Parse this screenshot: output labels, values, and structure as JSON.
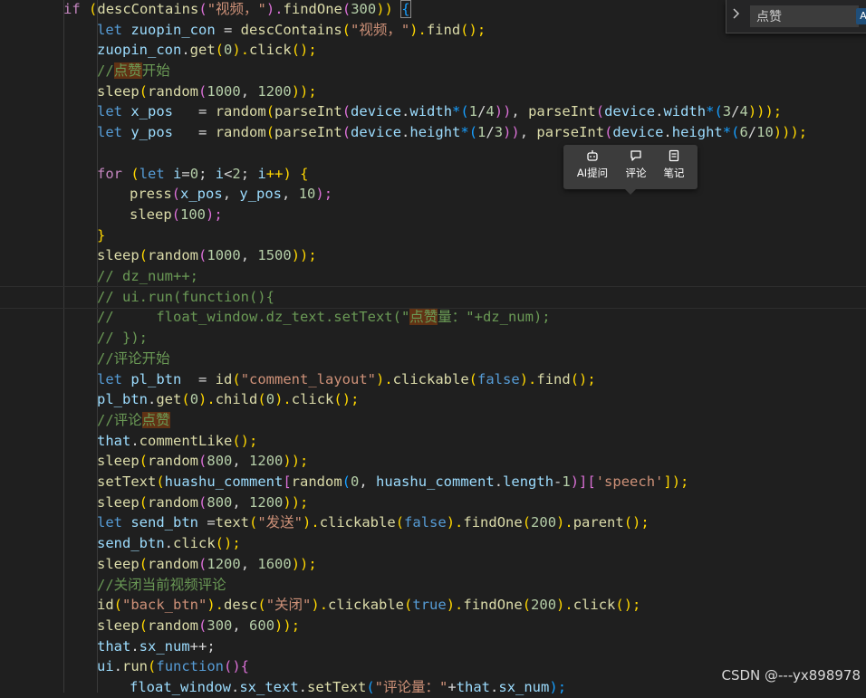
{
  "find_widget": {
    "query": "点赞",
    "toggle_icon": "chevron-right-icon",
    "case_label": "A"
  },
  "selection_toolbar": {
    "ai": "AI提问",
    "comment": "评论",
    "notes": "笔记"
  },
  "watermark": "CSDN @---yx898978",
  "code": {
    "l1": {
      "t1": "if",
      "t2": "(",
      "t3": "descContains",
      "t4": "(",
      "t5": "\"视频，\"",
      "t6": ").",
      "t7": "findOne",
      "t8": "(",
      "t9": "300",
      "t10": "))",
      "t11": "{"
    },
    "l2": {
      "t1": "let",
      "t2": "zuopin_con",
      "t3": " = ",
      "t4": "descContains",
      "t5": "(",
      "t6": "\"视频，\"",
      "t7": ").",
      "t8": "find",
      "t9": "();"
    },
    "l3": {
      "t1": "zuopin_con",
      "t2": ".",
      "t3": "get",
      "t4": "(",
      "t5": "0",
      "t6": ").",
      "t7": "click",
      "t8": "();"
    },
    "l4": {
      "t1": "//",
      "t2": "点赞",
      "t3": "开始"
    },
    "l5": {
      "t1": "sleep",
      "t2": "(",
      "t3": "random",
      "t4": "(",
      "t5": "1000",
      "t6": ", ",
      "t7": "1200",
      "t8": "));"
    },
    "l6": {
      "t1": "let",
      "t2": "x_pos",
      "t3": "   = ",
      "t4": "random",
      "t5": "(",
      "t6": "parseInt",
      "t7": "(",
      "t8": "device",
      "t9": ".",
      "t10": "width",
      "t11": "*(",
      "t12": "1",
      "t13": "/",
      "t14": "4",
      "t15": "))",
      "t16": ", ",
      "t17": "parseInt",
      "t18": "(",
      "t19": "device",
      "t20": ".",
      "t21": "width",
      "t22": "*(",
      "t23": "3",
      "t24": "/",
      "t25": "4",
      "t26": ")));"
    },
    "l7": {
      "t1": "let",
      "t2": "y_pos",
      "t3": "   = ",
      "t4": "random",
      "t5": "(",
      "t6": "parseInt",
      "t7": "(",
      "t8": "device",
      "t9": ".",
      "t10": "height",
      "t11": "*(",
      "t12": "1",
      "t13": "/",
      "t14": "3",
      "t15": "))",
      "t16": ", ",
      "t17": "parseInt",
      "t18": "(",
      "t19": "device",
      "t20": ".",
      "t21": "height",
      "t22": "*(",
      "t23": "6",
      "t24": "/",
      "t25": "10",
      "t26": ")));"
    },
    "l8": {
      "t1": "for",
      "t2": "(",
      "t3": "let",
      "t4": "i",
      "t5": "=",
      "t6": "0",
      "t7": "; ",
      "t8": "i",
      "t9": "<",
      "t10": "2",
      "t11": "; ",
      "t12": "i",
      "t13": "++) ",
      "t14": "{"
    },
    "l9": {
      "t1": "press",
      "t2": "(",
      "t3": "x_pos",
      "t4": ", ",
      "t5": "y_pos",
      "t6": ", ",
      "t7": "10",
      "t8": ");"
    },
    "l10": {
      "t1": "sleep",
      "t2": "(",
      "t3": "100",
      "t4": ");"
    },
    "l11": {
      "t1": "}"
    },
    "l12": {
      "t1": "sleep",
      "t2": "(",
      "t3": "random",
      "t4": "(",
      "t5": "1000",
      "t6": ", ",
      "t7": "1500",
      "t8": "));"
    },
    "l13": {
      "t1": "// dz_num++;"
    },
    "l14": {
      "t1": "// ui.run(function(){"
    },
    "l15": {
      "t1": "//     float_window.dz_text.setText(\"",
      "t2": "点赞",
      "t3": "量：\"+dz_num);"
    },
    "l16": {
      "t1": "// });"
    },
    "l17": {
      "t1": "//评论开始"
    },
    "l18": {
      "t1": "let",
      "t2": "pl_btn",
      "t3": "  = ",
      "t4": "id",
      "t5": "(",
      "t6": "\"comment_layout\"",
      "t7": ").",
      "t8": "clickable",
      "t9": "(",
      "t10": "false",
      "t11": ").",
      "t12": "find",
      "t13": "();"
    },
    "l19": {
      "t1": "pl_btn",
      "t2": ".",
      "t3": "get",
      "t4": "(",
      "t5": "0",
      "t6": ").",
      "t7": "child",
      "t8": "(",
      "t9": "0",
      "t10": ").",
      "t11": "click",
      "t12": "();"
    },
    "l20": {
      "t1": "//评论",
      "t2": "点赞"
    },
    "l21": {
      "t1": "that",
      "t2": ".",
      "t3": "commentLike",
      "t4": "();"
    },
    "l22": {
      "t1": "sleep",
      "t2": "(",
      "t3": "random",
      "t4": "(",
      "t5": "800",
      "t6": ", ",
      "t7": "1200",
      "t8": "));"
    },
    "l23": {
      "t1": "setText",
      "t2": "(",
      "t3": "huashu_comment",
      "t4": "[",
      "t5": "random",
      "t6": "(",
      "t7": "0",
      "t8": ", ",
      "t9": "huashu_comment",
      "t10": ".",
      "t11": "length",
      "t12": "-",
      "t13": "1",
      "t14": ")][",
      "t15": "'speech'",
      "t16": "]);"
    },
    "l24": {
      "t1": "sleep",
      "t2": "(",
      "t3": "random",
      "t4": "(",
      "t5": "800",
      "t6": ", ",
      "t7": "1200",
      "t8": "));"
    },
    "l25": {
      "t1": "let",
      "t2": "send_btn",
      "t3": " =",
      "t4": "text",
      "t5": "(",
      "t6": "\"发送\"",
      "t7": ").",
      "t8": "clickable",
      "t9": "(",
      "t10": "false",
      "t11": ").",
      "t12": "findOne",
      "t13": "(",
      "t14": "200",
      "t15": ").",
      "t16": "parent",
      "t17": "();"
    },
    "l26": {
      "t1": "send_btn",
      "t2": ".",
      "t3": "click",
      "t4": "();"
    },
    "l27": {
      "t1": "sleep",
      "t2": "(",
      "t3": "random",
      "t4": "(",
      "t5": "1200",
      "t6": ", ",
      "t7": "1600",
      "t8": "));"
    },
    "l28": {
      "t1": "//关闭当前视频评论"
    },
    "l29": {
      "t1": "id",
      "t2": "(",
      "t3": "\"back_btn\"",
      "t4": ").",
      "t5": "desc",
      "t6": "(",
      "t7": "\"关闭\"",
      "t8": ").",
      "t9": "clickable",
      "t10": "(",
      "t11": "true",
      "t12": ").",
      "t13": "findOne",
      "t14": "(",
      "t15": "200",
      "t16": ").",
      "t17": "click",
      "t18": "();"
    },
    "l30": {
      "t1": "sleep",
      "t2": "(",
      "t3": "random",
      "t4": "(",
      "t5": "300",
      "t6": ", ",
      "t7": "600",
      "t8": "));"
    },
    "l31": {
      "t1": "that",
      "t2": ".",
      "t3": "sx_num",
      "t4": "++;"
    },
    "l32": {
      "t1": "ui",
      "t2": ".",
      "t3": "run",
      "t4": "(",
      "t5": "function",
      "t6": "(){"
    },
    "l33": {
      "t1": "float_window",
      "t2": ".",
      "t3": "sx_text",
      "t4": ".",
      "t5": "setText",
      "t6": "(",
      "t7": "\"评论量：\"",
      "t8": "+",
      "t9": "that",
      "t10": ".",
      "t11": "sx_num",
      "t12": ");"
    }
  }
}
